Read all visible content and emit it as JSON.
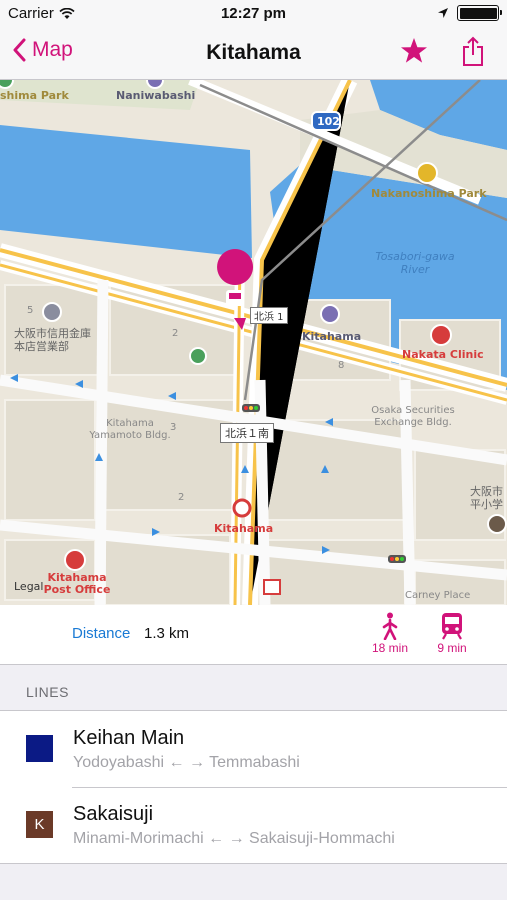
{
  "status_bar": {
    "carrier": "Carrier",
    "time": "12:27 pm"
  },
  "nav": {
    "back_label": "Map",
    "title": "Kitahama"
  },
  "map": {
    "labels": {
      "shima_park": "shima Park",
      "naniwabashi": "Naniwabashi",
      "route_102": "102",
      "nakanoshima_park": "Nakanoshima Park",
      "river": "Tosabori-gawa River",
      "station_kitahama": "Kitahama",
      "nakata_clinic": "Nakata Clinic",
      "shinkin": "大阪市信用金庫本店営業部",
      "crossing_1": "北浜 1",
      "crossing_2": "北浜１南",
      "yamamoto": "Kitahama Yamamoto Bldg.",
      "osaka_sec": "Osaka Securities Exchange Bldg.",
      "kitahama_red": "Kitahama",
      "post_office": "Kitahama Post Office",
      "carney": "Carney Place",
      "hiranomachi": "大阪市平小学",
      "legal": "Legal",
      "block_2": "2",
      "block_3": "3",
      "block_5": "5",
      "block_8": "8",
      "block_2b": "2"
    }
  },
  "info": {
    "distance_label": "Distance",
    "distance_value": "1.3 km",
    "walk_time": "18 min",
    "train_time": "9 min"
  },
  "section": {
    "lines_header": "LINES"
  },
  "lines": [
    {
      "name": "Keihan Main",
      "route": "Yodoyabashi ← → Temmabashi",
      "color": "#0b1a85",
      "letter": ""
    },
    {
      "name": "Sakaisuji",
      "route": "Minami-Morimachi ← → Sakaisuji-Hommachi",
      "color": "#6b3a28",
      "letter": "K"
    }
  ],
  "colors": {
    "accent": "#d1137a",
    "link": "#1a7ad4",
    "water": "#5fa7e6"
  }
}
